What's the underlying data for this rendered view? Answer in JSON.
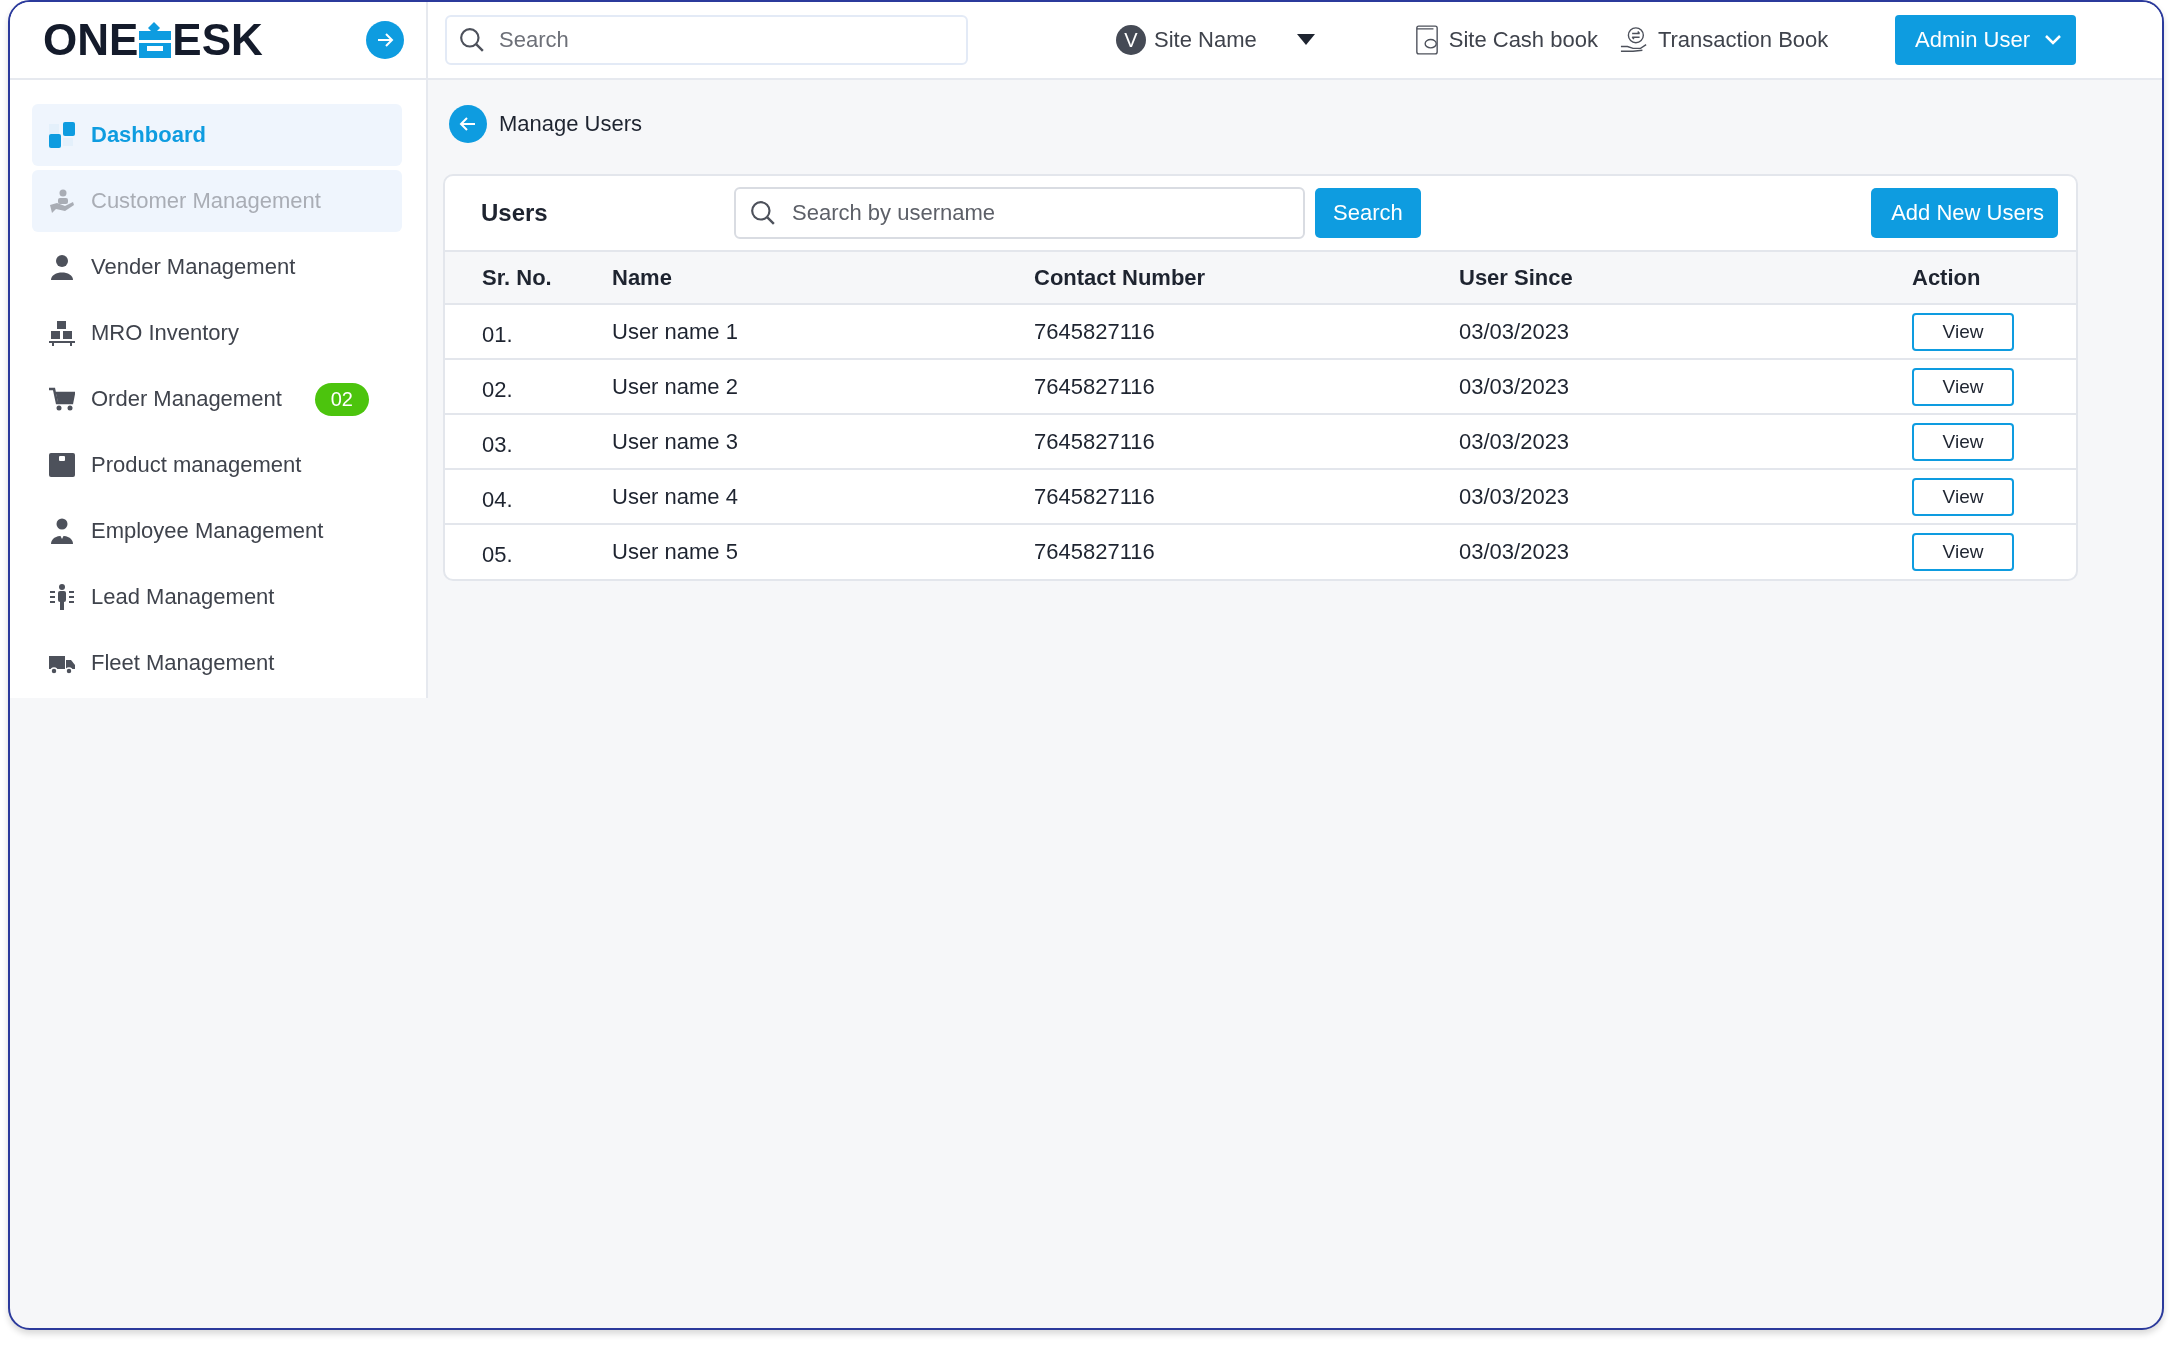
{
  "logo": {
    "left": "ONE",
    "right": "ESK"
  },
  "header": {
    "search": {
      "placeholder": "Search"
    },
    "site": {
      "avatar": "V",
      "name": "Site Name"
    },
    "links": [
      {
        "label": "Site Cash book",
        "kind": "cashbook"
      },
      {
        "label": "Transaction Book",
        "kind": "transaction"
      }
    ],
    "user_menu": "Admin User"
  },
  "sidebar": {
    "items": [
      {
        "label": "Dashboard",
        "selected": true,
        "disabled": false
      },
      {
        "label": "Customer Management",
        "selected": false,
        "disabled": true
      },
      {
        "label": "Vender Management",
        "selected": false,
        "disabled": false
      },
      {
        "label": "MRO Inventory",
        "selected": false,
        "disabled": false
      },
      {
        "label": "Order Management",
        "selected": false,
        "disabled": false,
        "badge": "02"
      },
      {
        "label": "Product management",
        "selected": false,
        "disabled": false
      },
      {
        "label": "Employee Management",
        "selected": false,
        "disabled": false
      },
      {
        "label": "Lead Management",
        "selected": false,
        "disabled": false
      },
      {
        "label": "Fleet Management",
        "selected": false,
        "disabled": false
      }
    ]
  },
  "page_title": "Manage Users",
  "users_card": {
    "title": "Users",
    "search": {
      "placeholder": "Search by username"
    },
    "search_button": "Search",
    "add_button": "Add New Users",
    "table": {
      "columns": [
        "Sr. No.",
        "Name",
        "Contact Number",
        "User Since",
        "Action"
      ],
      "rows": [
        {
          "sr": "01.",
          "name": "User name 1",
          "contact": "7645827116",
          "since": "03/03/2023",
          "action": "View"
        },
        {
          "sr": "02.",
          "name": "User name 2",
          "contact": "7645827116",
          "since": "03/03/2023",
          "action": "View"
        },
        {
          "sr": "03.",
          "name": "User name 3",
          "contact": "7645827116",
          "since": "03/03/2023",
          "action": "View"
        },
        {
          "sr": "04.",
          "name": "User name 4",
          "contact": "7645827116",
          "since": "03/03/2023",
          "action": "View"
        },
        {
          "sr": "05.",
          "name": "User name 5",
          "contact": "7645827116",
          "since": "03/03/2023",
          "action": "View"
        }
      ]
    }
  }
}
